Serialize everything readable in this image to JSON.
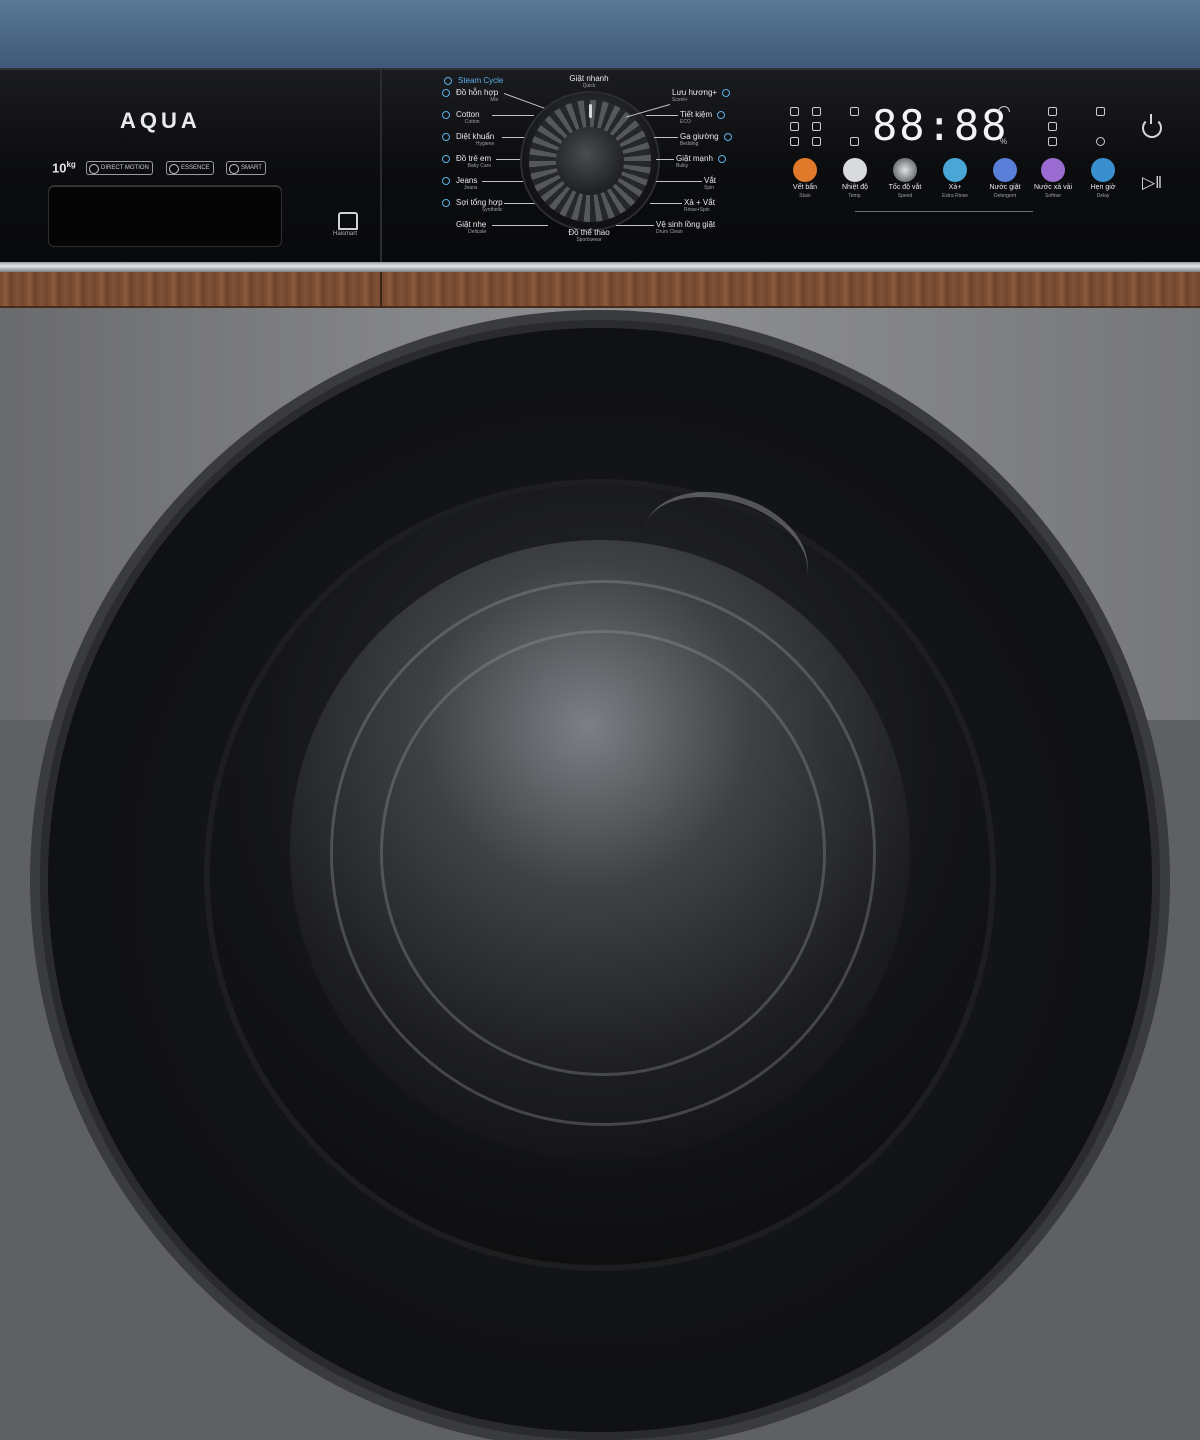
{
  "brand": {
    "logo": "AQUA"
  },
  "left_panel": {
    "capacity_value": "10",
    "capacity_unit": "kg",
    "badges": [
      "DIRECT MOTION",
      "ESSENCE",
      "SMART"
    ],
    "home_label": "Haismart"
  },
  "programs_left": [
    {
      "label": "Steam Cycle",
      "sub": ""
    },
    {
      "label": "Đồ hỗn hợp",
      "sub": "Mix"
    },
    {
      "label": "Cotton",
      "sub": "Cotton"
    },
    {
      "label": "Diệt khuẩn",
      "sub": "Hygiene"
    },
    {
      "label": "Đồ trẻ em",
      "sub": "Baby Care"
    },
    {
      "label": "Jeans",
      "sub": "Jeans"
    },
    {
      "label": "Sợi tổng hợp",
      "sub": "Synthetic"
    },
    {
      "label": "Giặt nhẹ",
      "sub": "Delicate"
    }
  ],
  "programs_right": [
    {
      "label": "Lưu hương+",
      "sub": "Scent+"
    },
    {
      "label": "Tiết kiệm",
      "sub": "ECO"
    },
    {
      "label": "Ga giường",
      "sub": "Bedding"
    },
    {
      "label": "Giặt mạnh",
      "sub": "Bulky"
    },
    {
      "label": "Vắt",
      "sub": "Spin"
    },
    {
      "label": "Xả + Vắt",
      "sub": "Rinse+Spin"
    },
    {
      "label": "Vệ sinh lồng giặt",
      "sub": "Drum Clean"
    }
  ],
  "program_top": {
    "label": "Giặt nhanh",
    "sub": "Quick"
  },
  "program_bottom": {
    "label": "Đồ thể thao",
    "sub": "Sportswear"
  },
  "display": {
    "time": "88:88",
    "percent": "%"
  },
  "functions": [
    {
      "label": "Vết bẩn",
      "sub": "Stain",
      "color": "#e07a2a"
    },
    {
      "label": "Nhiệt độ",
      "sub": "Temp.",
      "color": "#d8dadc"
    },
    {
      "label": "Tốc độ vắt",
      "sub": "Speed",
      "color": "#9ea1a6"
    },
    {
      "label": "Xả+",
      "sub": "Extra Rinse",
      "color": "#4aa6d6"
    },
    {
      "label": "Nước giặt",
      "sub": "Detergent",
      "color": "#5a7fd8"
    },
    {
      "label": "Nước xả vải",
      "sub": "Softner",
      "color": "#9a6bd0"
    },
    {
      "label": "Hẹn giờ",
      "sub": "Delay",
      "color": "#3a8fcf"
    }
  ],
  "controls": {
    "power_icon": "power-icon",
    "start_pause_icon": "play-pause-icon",
    "start_pause_glyph": "▷‖"
  }
}
